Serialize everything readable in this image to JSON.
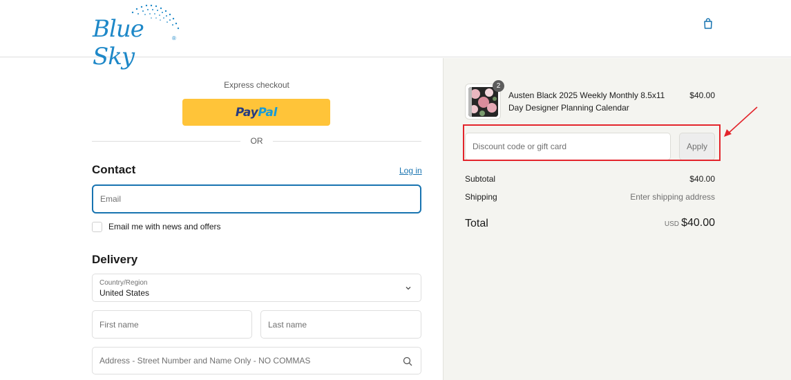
{
  "header": {
    "logo_text": "Blue Sky",
    "logo_reg": "®",
    "cart_icon": "shopping-bag-icon"
  },
  "express": {
    "label": "Express checkout",
    "paypal_part1": "Pay",
    "paypal_part2": "Pal",
    "or": "OR"
  },
  "contact": {
    "title": "Contact",
    "login_link": "Log in",
    "email_placeholder": "Email",
    "newsletter_label": "Email me with news and offers",
    "newsletter_checked": false
  },
  "delivery": {
    "title": "Delivery",
    "country_label": "Country/Region",
    "country_value": "United States",
    "first_name_placeholder": "First name",
    "last_name_placeholder": "Last name",
    "address_placeholder": "Address - Street Number and Name Only - NO COMMAS"
  },
  "summary": {
    "item": {
      "quantity": "2",
      "name": "Austen Black 2025 Weekly Monthly 8.5x11 Day Designer Planning Calendar",
      "price": "$40.00"
    },
    "discount_placeholder": "Discount code or gift card",
    "apply_label": "Apply",
    "subtotal_label": "Subtotal",
    "subtotal_value": "$40.00",
    "shipping_label": "Shipping",
    "shipping_value": "Enter shipping address",
    "total_label": "Total",
    "total_currency": "USD",
    "total_value": "$40.00"
  },
  "colors": {
    "brand_blue": "#1e88c8",
    "link_blue": "#1773b0",
    "paypal_yellow": "#ffc439",
    "highlight_red": "#e3242b",
    "summary_bg": "#f4f4f0"
  }
}
